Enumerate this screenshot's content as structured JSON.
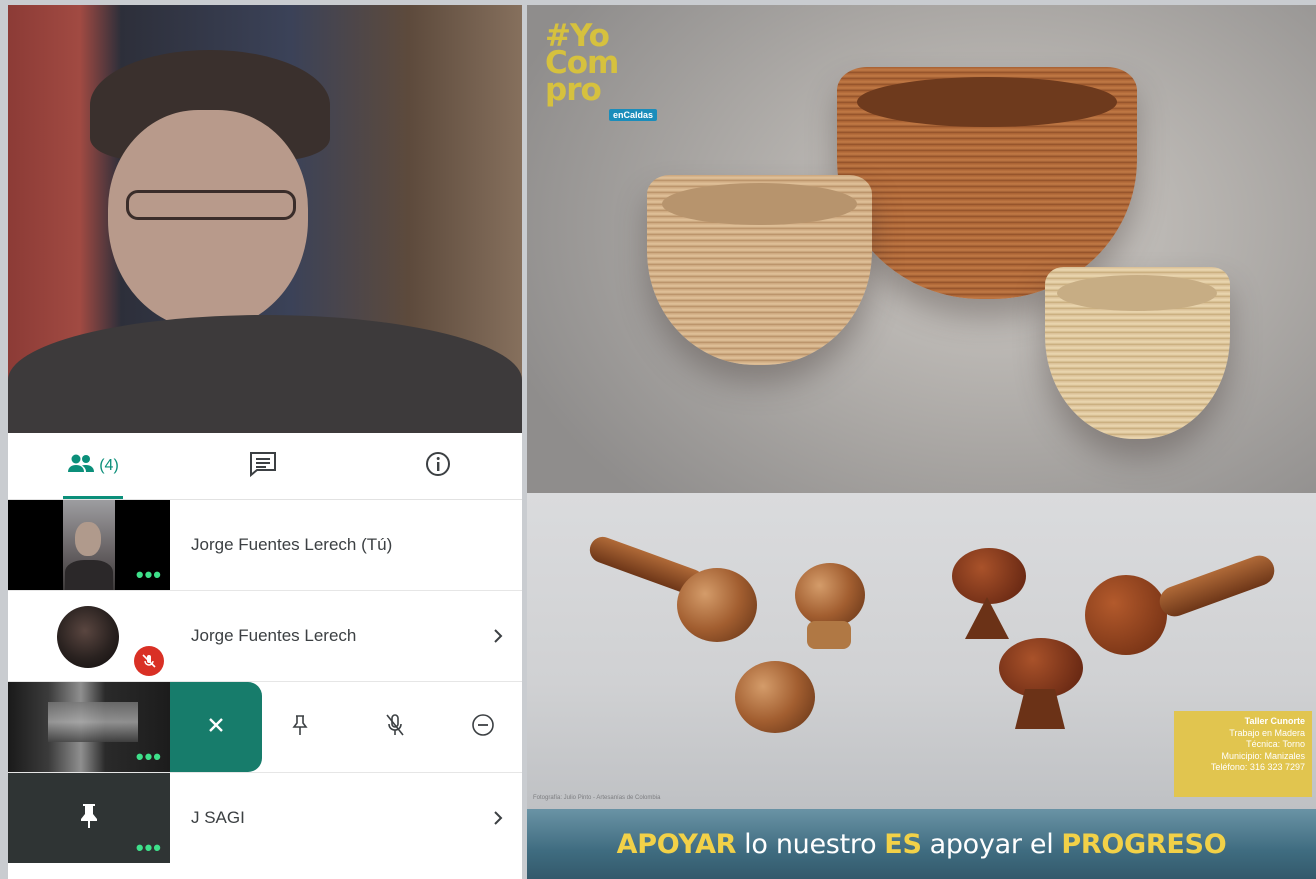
{
  "participants_tab": {
    "count_label": "(4)"
  },
  "participants": [
    {
      "name": "Jorge Fuentes Lerech (Tú)"
    },
    {
      "name": "Jorge Fuentes Lerech"
    },
    {
      "name": ""
    },
    {
      "name": "J SAGI"
    }
  ],
  "presentation": {
    "logo": {
      "line1": "#Yo",
      "line2": "Com",
      "line3": "pro",
      "tag": "enCaldas"
    },
    "info_card": {
      "title": "Taller Cunorte",
      "line1": "Trabajo en Madera",
      "line2": "Técnica: Torno",
      "line3": "Municipio: Manizales",
      "line4": "Teléfono: 316 323 7297"
    },
    "photo_credit": "Fotografía: Julio Pinto - Artesanías de Colombia",
    "banner": {
      "w1": "APOYAR",
      "w2": "lo nuestro",
      "w3": "ES",
      "w4": "apoyar el",
      "w5": "PROGRESO"
    }
  },
  "colors": {
    "accent": "#0b8f7a",
    "mute_red": "#d93025",
    "highlight_yellow": "#f2d148"
  },
  "icons": [
    "people-icon",
    "chat-icon",
    "info-icon",
    "more-icon",
    "mic-off-icon",
    "chevron-right-icon",
    "close-icon",
    "pin-icon",
    "remove-icon"
  ]
}
